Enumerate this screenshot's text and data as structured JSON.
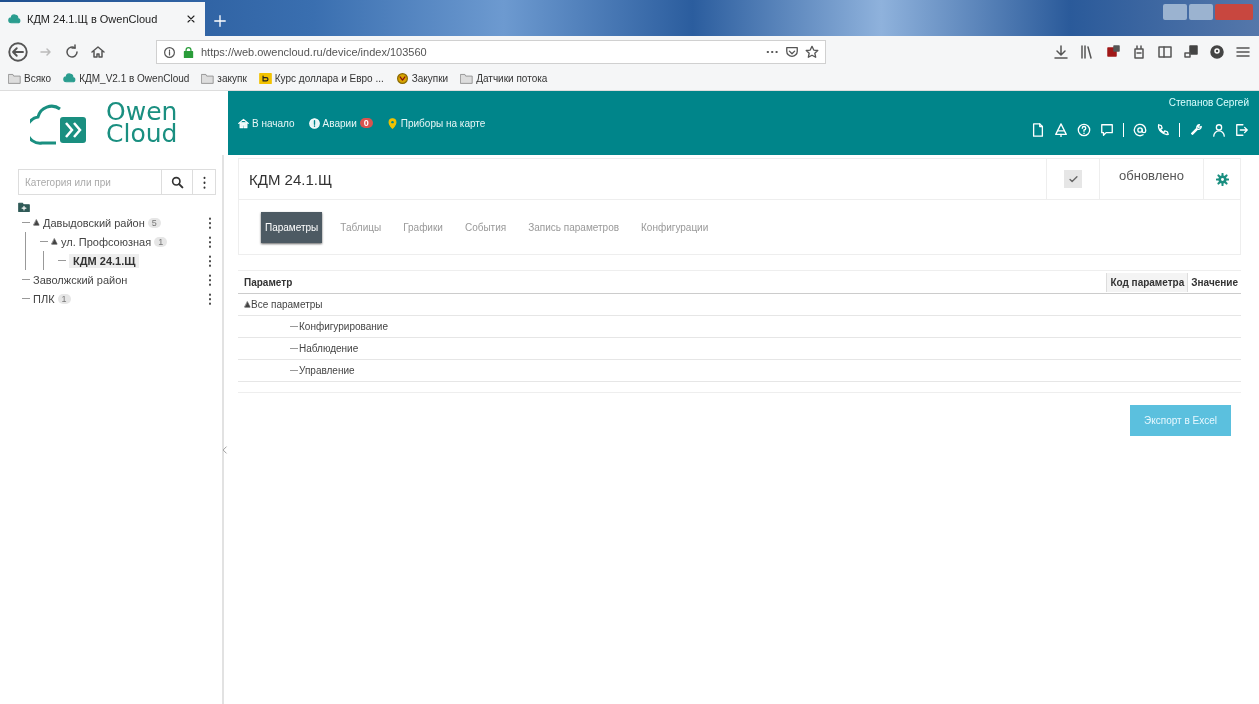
{
  "browser": {
    "tab_title": "КДМ 24.1.Щ в OwenCloud",
    "url": "https://web.owencloud.ru/device/index/103560",
    "bookmarks": [
      {
        "label": "Всяко",
        "kind": "folder"
      },
      {
        "label": "КДМ_V2.1 в OwenCloud",
        "kind": "cloud"
      },
      {
        "label": "закупк",
        "kind": "folder"
      },
      {
        "label": "Курс доллара и Евро ...",
        "kind": "site"
      },
      {
        "label": "Закупки",
        "kind": "emblem"
      },
      {
        "label": "Датчики потока",
        "kind": "folder"
      }
    ]
  },
  "header": {
    "logo": [
      "Owen",
      "Cloud"
    ],
    "user": "Степанов Сергей",
    "nav": [
      {
        "label": "В начало",
        "kind": "home"
      },
      {
        "label": "Аварии",
        "kind": "alarm",
        "badge": "0"
      },
      {
        "label": "Приборы на карте",
        "kind": "map"
      }
    ]
  },
  "sidebar": {
    "search": {
      "placeholder": "Категория или при"
    },
    "tree": [
      {
        "label": "Давыдовский район",
        "count": "5",
        "selected": false,
        "children": [
          {
            "label": "ул. Профсоюзная",
            "count": "1",
            "selected": false,
            "children": [
              {
                "label": "КДМ 24.1.Щ",
                "selected": true
              }
            ]
          }
        ]
      },
      {
        "label": "Заволжский район",
        "selected": false
      },
      {
        "label": "ПЛК",
        "count": "1",
        "selected": false
      }
    ]
  },
  "device": {
    "title": "КДМ 24.1.Щ",
    "auto_update": true,
    "status": "обновлено",
    "tabs": [
      {
        "label": "Параметры",
        "selected": true
      },
      {
        "label": "Таблицы",
        "selected": false
      },
      {
        "label": "Графики",
        "selected": false
      },
      {
        "label": "События",
        "selected": false
      },
      {
        "label": "Запись параметров",
        "selected": false
      },
      {
        "label": "Конфигурации",
        "selected": false
      }
    ],
    "columns": [
      "Параметр",
      "Код параметра",
      "Значение"
    ],
    "rows": [
      {
        "label": "Все параметры",
        "children": [
          {
            "label": "Конфигурирование"
          },
          {
            "label": "Наблюдение"
          },
          {
            "label": "Управление"
          }
        ]
      }
    ],
    "export_button": "Экспорт в Excel"
  }
}
